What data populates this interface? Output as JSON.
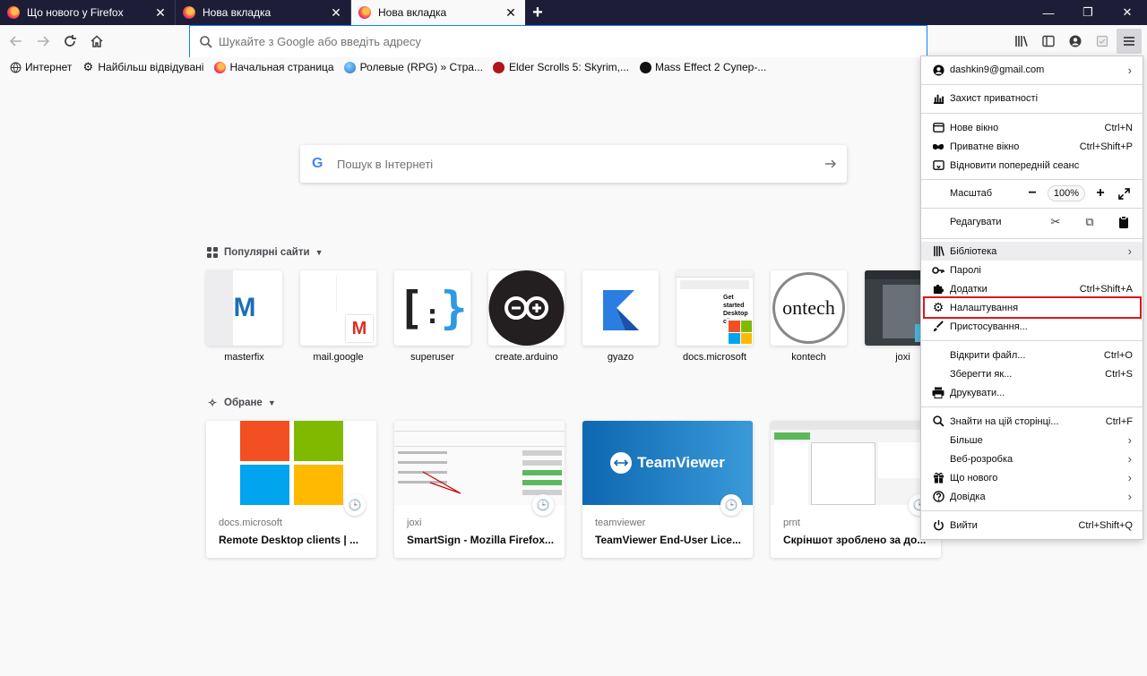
{
  "tabs": [
    {
      "title": "Що нового у Firefox",
      "close": "✕"
    },
    {
      "title": "Нова вкладка",
      "close": "✕"
    },
    {
      "title": "Нова вкладка",
      "close": "✕",
      "active": true
    }
  ],
  "new_tab": "+",
  "window_controls": {
    "minimize": "—",
    "maximize": "❐",
    "close": "✕"
  },
  "urlbar": {
    "placeholder": "Шукайте з Google або введіть адресу"
  },
  "bookmarks": [
    {
      "label": "Интернет",
      "icon": "globe-icon"
    },
    {
      "label": "Найбільш відвідувані",
      "icon": "gear-icon"
    },
    {
      "label": "Начальная страница",
      "icon": "firefox-icon"
    },
    {
      "label": "Ролевые (RPG) » Стра...",
      "icon": "globe-icon"
    },
    {
      "label": "Elder Scrolls 5: Skyrim,...",
      "icon": "ps-icon"
    },
    {
      "label": "Mass Effect 2 Супер-...",
      "icon": "site-icon"
    }
  ],
  "search": {
    "placeholder": "Пошук в Інтернеті",
    "logo": "G"
  },
  "topsites_section": {
    "title": "Популярні сайти"
  },
  "topsites": [
    {
      "label": "masterfix"
    },
    {
      "label": "mail.google"
    },
    {
      "label": "superuser"
    },
    {
      "label": "create.arduino"
    },
    {
      "label": "gyazo"
    },
    {
      "label": "docs.microsoft"
    },
    {
      "label": "kontech"
    },
    {
      "label": "joxi"
    }
  ],
  "highlights_section": {
    "title": "Обране"
  },
  "highlights": [
    {
      "host": "docs.microsoft",
      "title": "Remote Desktop clients | ..."
    },
    {
      "host": "joxi",
      "title": "SmartSign - Mozilla Firefox..."
    },
    {
      "host": "teamviewer",
      "title": "TeamViewer End-User Lice..."
    },
    {
      "host": "prnt",
      "title": "Скріншот зроблено за до..."
    }
  ],
  "thumb_text": {
    "masterfix": "M",
    "gmail": "M",
    "superuser": "[:}",
    "arduino": "⊖⊕",
    "kontech": "ontech",
    "teamviewer": "TeamViewer",
    "docs_title": "Get started Desktop cli"
  },
  "menu": {
    "account": "dashkin9@gmail.com",
    "privacy": "Захист приватності",
    "new_window": "Нове вікно",
    "new_window_sc": "Ctrl+N",
    "private_window": "Приватне вікно",
    "private_window_sc": "Ctrl+Shift+P",
    "restore_session": "Відновити попередній сеанс",
    "zoom_label": "Масштаб",
    "zoom_minus": "−",
    "zoom_value": "100%",
    "zoom_plus": "+",
    "edit_label": "Редагувати",
    "library": "Бібліотека",
    "passwords": "Паролі",
    "addons": "Додатки",
    "addons_sc": "Ctrl+Shift+A",
    "settings": "Налаштування",
    "customize": "Пристосування...",
    "open_file": "Відкрити файл...",
    "open_file_sc": "Ctrl+O",
    "save_as": "Зберегти як...",
    "save_as_sc": "Ctrl+S",
    "print": "Друкувати...",
    "find": "Знайти на цій сторінці...",
    "find_sc": "Ctrl+F",
    "more": "Більше",
    "web_dev": "Веб-розробка",
    "whats_new": "Що нового",
    "help": "Довідка",
    "quit": "Вийти",
    "quit_sc": "Ctrl+Shift+Q"
  },
  "colors": {
    "accent": "#0a84ff",
    "highlight": "#e0161b",
    "tabstrip": "#1d1d38"
  }
}
